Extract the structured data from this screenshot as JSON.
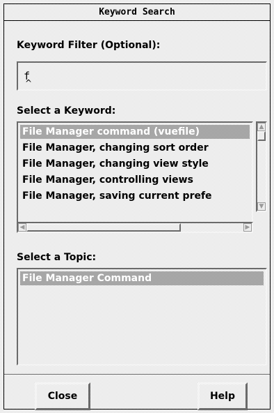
{
  "window": {
    "title": "Keyword Search"
  },
  "filter": {
    "label": "Keyword Filter (Optional):",
    "value": "f"
  },
  "keywords": {
    "label": "Select a Keyword:",
    "items": [
      {
        "label": "File Manager command (vuefile)",
        "selected": true
      },
      {
        "label": "File Manager, changing sort order",
        "selected": false
      },
      {
        "label": "File Manager, changing view style",
        "selected": false
      },
      {
        "label": "File Manager, controlling views",
        "selected": false
      },
      {
        "label": "File Manager, saving current prefe",
        "selected": false
      }
    ]
  },
  "topics": {
    "label": "Select a Topic:",
    "items": [
      {
        "label": "File Manager Command",
        "selected": true
      }
    ]
  },
  "buttons": {
    "close": "Close",
    "help": "Help"
  },
  "icons": {
    "up": "scroll-up-arrow-icon",
    "down": "scroll-down-arrow-icon",
    "left": "scroll-left-arrow-icon",
    "right": "scroll-right-arrow-icon",
    "caret": "text-caret-icon"
  }
}
